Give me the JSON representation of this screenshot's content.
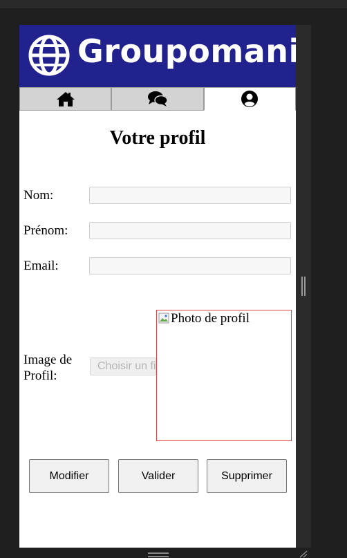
{
  "app": {
    "brand_name": "Groupomania"
  },
  "nav": {
    "tabs": [
      {
        "icon": "home-icon",
        "active": false
      },
      {
        "icon": "chat-icon",
        "active": false
      },
      {
        "icon": "user-circle-icon",
        "active": true
      }
    ]
  },
  "profile": {
    "title": "Votre profil",
    "fields": {
      "nom": {
        "label": "Nom:",
        "value": ""
      },
      "prenom": {
        "label": "Prénom:",
        "value": ""
      },
      "email": {
        "label": "Email:",
        "value": ""
      }
    },
    "image": {
      "label": "Image de Profil:",
      "file_button": "Choisir un fichier",
      "photo_alt": "Photo de profil"
    }
  },
  "actions": {
    "modify": "Modifier",
    "validate": "Valider",
    "delete": "Supprimer"
  },
  "colors": {
    "banner": "#22228f",
    "photo_border": "#e04040",
    "tab_inactive": "#d3d3d3"
  }
}
